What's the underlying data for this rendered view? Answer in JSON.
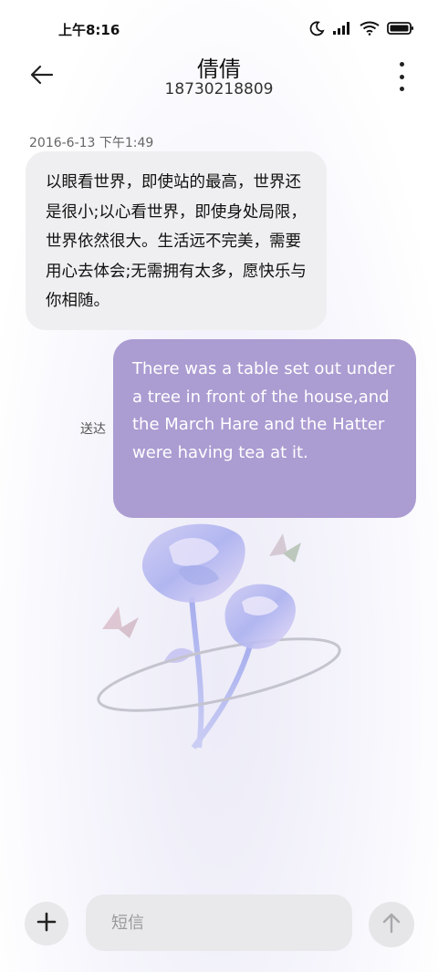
{
  "status_bar": {
    "time": "上午8:16",
    "icons": [
      "moon-icon",
      "signal-icon",
      "wifi-icon",
      "battery-icon"
    ]
  },
  "header": {
    "contact_name": "倩倩",
    "contact_number": "18730218809",
    "back_icon": "arrow-left-icon",
    "more_icon": "more-vertical-icon"
  },
  "conversation": {
    "timestamp": "2016-6-13 下午1:49",
    "messages": [
      {
        "direction": "incoming",
        "text": "以眼看世界，即使站的最高，世界还是很小;以心看世界，即使身处局限，世界依然很大。生活远不完美，需要用心去体会;无需拥有太多，愿快乐与你相随。"
      },
      {
        "direction": "outgoing",
        "text": "There was a table set out under a tree in front of the house,and the March Hare and the Hatter were having tea at it.",
        "status": "送达"
      }
    ]
  },
  "composer": {
    "placeholder": "短信",
    "value": "",
    "add_icon": "plus-icon",
    "send_icon": "arrow-up-icon"
  },
  "colors": {
    "outgoing_bubble": "#ab9cd2",
    "incoming_bubble": "#efeff1"
  }
}
